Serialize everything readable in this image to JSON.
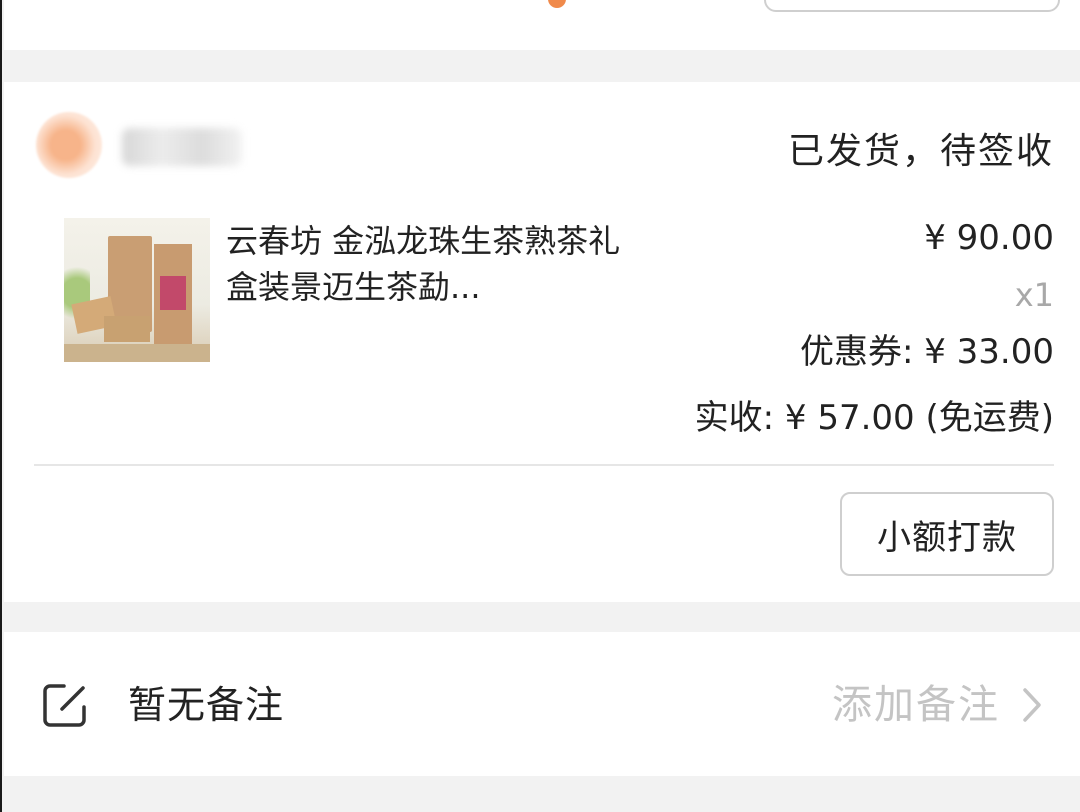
{
  "order": {
    "status": "已发货，待签收",
    "product": {
      "title": "云春坊 金泓龙珠生茶熟茶礼盒装景迈生茶勐...",
      "price": "¥ 90.00",
      "quantity": "x1"
    },
    "coupon": "优惠券: ¥ 33.00",
    "received": "实收: ¥ 57.00 (免运费)",
    "action_label": "小额打款"
  },
  "remark": {
    "text": "暂无备注",
    "add_label": "添加备注"
  },
  "icons": {
    "edit": "edit-note-icon",
    "chevron": "chevron-right-icon"
  },
  "colors": {
    "background": "#f2f2f2",
    "muted_text": "#a8a8a8",
    "placeholder_text": "#c4c4c4",
    "accent_dot": "#f08a4b"
  }
}
